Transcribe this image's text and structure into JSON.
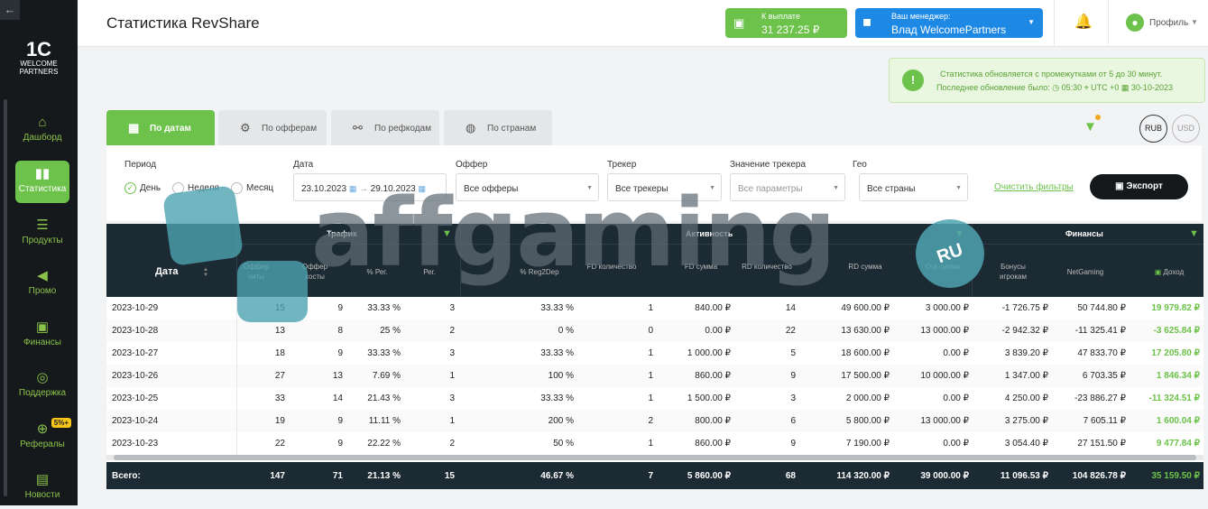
{
  "sidebar": {
    "collapse_icon": "←",
    "logo_line1": "1C",
    "logo_line2": "WELCOME",
    "logo_line3": "PARTNERS",
    "items": [
      {
        "label": "Дашборд",
        "icon": "⌂"
      },
      {
        "label": "Статистика",
        "icon": "▮▮"
      },
      {
        "label": "Продукты",
        "icon": "☰"
      },
      {
        "label": "Промо",
        "icon": "◀"
      },
      {
        "label": "Финансы",
        "icon": "▣"
      },
      {
        "label": "Поддержка",
        "icon": "◎"
      },
      {
        "label": "Рефералы",
        "icon": "⊕",
        "badge": "5%+"
      },
      {
        "label": "Новости",
        "icon": "▤"
      }
    ]
  },
  "header": {
    "title": "Статистика RevShare",
    "payout_label": "К выплате",
    "payout_value": "31 237.25 ₽",
    "manager_label": "Ваш менеджер:",
    "manager_name": "Влад WelcomePartners",
    "profile_label": "Профиль"
  },
  "notice": {
    "line1": "Статистика обновляется с промежутками от 5 до 30 минут.",
    "line2": "Последнее обновление было:  ◷ 05:30  ⌖ UTC +0  ▦ 30-10-2023"
  },
  "tabs": [
    {
      "label": "По датам",
      "icon": "▦"
    },
    {
      "label": "По офферам",
      "icon": "⚙"
    },
    {
      "label": "По рефкодам",
      "icon": "⚯"
    },
    {
      "label": "По странам",
      "icon": "◍"
    }
  ],
  "currency": {
    "rub": "RUB",
    "usd": "USD"
  },
  "filters": {
    "period_label": "Период",
    "period_options": [
      "День",
      "Неделя",
      "Месяц"
    ],
    "date_label": "Дата",
    "date_from": "23.10.2023",
    "date_to": "29.10.2023",
    "offer_label": "Оффер",
    "offer_value": "Все офферы",
    "tracker_label": "Трекер",
    "tracker_value": "Все трекеры",
    "tracker_value_label": "Значение трекера",
    "tracker_value_placeholder": "Все параметры",
    "geo_label": "Гео",
    "geo_value": "Все страны",
    "clear_label": "Очистить фильтры",
    "export_label": "Экспорт"
  },
  "table": {
    "groups": {
      "traffic": "Трафик",
      "activity": "Активность",
      "finance": "Финансы"
    },
    "date_header": "Дата",
    "columns": [
      "Оффер хиты",
      "Оффер хосты",
      "% Рег.",
      "Рег.",
      "% Reg2Dep",
      "FD количество",
      "FD сумма",
      "RD количество",
      "RD сумма",
      "Out сумма",
      "Бонусы игрокам",
      "NetGaming",
      "Доход"
    ],
    "rows": [
      [
        "2023-10-29",
        "15",
        "9",
        "33.33 %",
        "3",
        "33.33 %",
        "1",
        "840.00 ₽",
        "14",
        "49 600.00 ₽",
        "3 000.00 ₽",
        "-1 726.75 ₽",
        "50 744.80 ₽",
        "19 979.82 ₽"
      ],
      [
        "2023-10-28",
        "13",
        "8",
        "25 %",
        "2",
        "0 %",
        "0",
        "0.00 ₽",
        "22",
        "13 630.00 ₽",
        "13 000.00 ₽",
        "-2 942.32 ₽",
        "-11 325.41 ₽",
        "-3 625.84 ₽"
      ],
      [
        "2023-10-27",
        "18",
        "9",
        "33.33 %",
        "3",
        "33.33 %",
        "1",
        "1 000.00 ₽",
        "5",
        "18 600.00 ₽",
        "0.00 ₽",
        "3 839.20 ₽",
        "47 833.70 ₽",
        "17 205.80 ₽"
      ],
      [
        "2023-10-26",
        "27",
        "13",
        "7.69 %",
        "1",
        "100 %",
        "1",
        "860.00 ₽",
        "9",
        "17 500.00 ₽",
        "10 000.00 ₽",
        "1 347.00 ₽",
        "6 703.35 ₽",
        "1 846.34 ₽"
      ],
      [
        "2023-10-25",
        "33",
        "14",
        "21.43 %",
        "3",
        "33.33 %",
        "1",
        "1 500.00 ₽",
        "3",
        "2 000.00 ₽",
        "0.00 ₽",
        "4 250.00 ₽",
        "-23 886.27 ₽",
        "-11 324.51 ₽"
      ],
      [
        "2023-10-24",
        "19",
        "9",
        "11.11 %",
        "1",
        "200 %",
        "2",
        "800.00 ₽",
        "6",
        "5 800.00 ₽",
        "13 000.00 ₽",
        "3 275.00 ₽",
        "7 605.11 ₽",
        "1 600.04 ₽"
      ],
      [
        "2023-10-23",
        "22",
        "9",
        "22.22 %",
        "2",
        "50 %",
        "1",
        "860.00 ₽",
        "9",
        "7 190.00 ₽",
        "0.00 ₽",
        "3 054.40 ₽",
        "27 151.50 ₽",
        "9 477.84 ₽"
      ]
    ],
    "totals": [
      "Всего:",
      "147",
      "71",
      "21.13 %",
      "15",
      "46.67 %",
      "7",
      "5 860.00 ₽",
      "68",
      "114 320.00 ₽",
      "39 000.00 ₽",
      "11 096.53 ₽",
      "104 826.78 ₽",
      "35 159.50 ₽"
    ]
  },
  "watermark": {
    "text": "affgaming",
    "badge": "RU"
  }
}
